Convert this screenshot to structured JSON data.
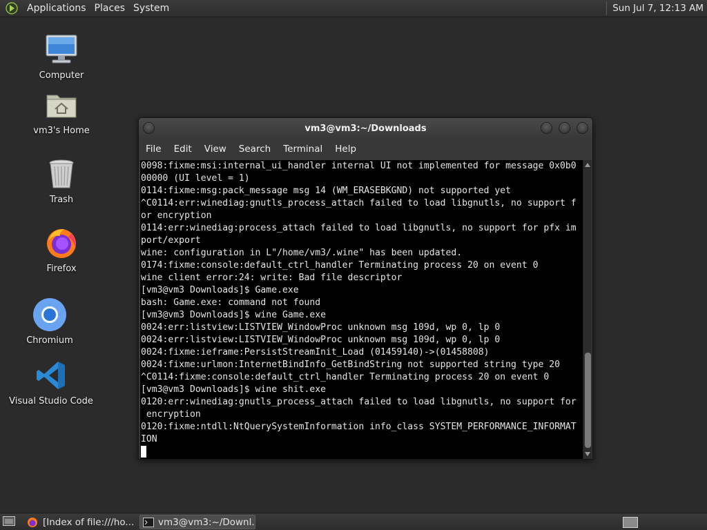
{
  "top_panel": {
    "menus": [
      "Applications",
      "Places",
      "System"
    ],
    "clock": "Sun Jul  7, 12:13 AM"
  },
  "desktop": {
    "icons": [
      {
        "label": "Computer",
        "icon": "computer-icon"
      },
      {
        "label": "vm3's Home",
        "icon": "home-folder-icon"
      },
      {
        "label": "Trash",
        "icon": "trash-icon"
      },
      {
        "label": "Firefox",
        "icon": "firefox-icon"
      },
      {
        "label": "Chromium",
        "icon": "chromium-icon"
      },
      {
        "label": "Visual Studio Code",
        "icon": "vscode-icon"
      }
    ]
  },
  "terminal": {
    "title": "vm3@vm3:~/Downloads",
    "menu": [
      "File",
      "Edit",
      "View",
      "Search",
      "Terminal",
      "Help"
    ],
    "lines": [
      "0098:fixme:msi:internal_ui_handler internal UI not implemented for message 0x0b0",
      "00000 (UI level = 1)",
      "0114:fixme:msg:pack_message msg 14 (WM_ERASEBKGND) not supported yet",
      "^C0114:err:winediag:gnutls_process_attach failed to load libgnutls, no support f",
      "or encryption",
      "0114:err:winediag:process_attach failed to load libgnutls, no support for pfx im",
      "port/export",
      "wine: configuration in L\"/home/vm3/.wine\" has been updated.",
      "0174:fixme:console:default_ctrl_handler Terminating process 20 on event 0",
      "wine client error:24: write: Bad file descriptor",
      "[vm3@vm3 Downloads]$ Game.exe",
      "bash: Game.exe: command not found",
      "[vm3@vm3 Downloads]$ wine Game.exe",
      "0024:err:listview:LISTVIEW_WindowProc unknown msg 109d, wp 0, lp 0",
      "0024:err:listview:LISTVIEW_WindowProc unknown msg 109d, wp 0, lp 0",
      "0024:fixme:ieframe:PersistStreamInit_Load (01459140)->(01458808)",
      "0024:fixme:urlmon:InternetBindInfo_GetBindString not supported string type 20",
      "^C0114:fixme:console:default_ctrl_handler Terminating process 20 on event 0",
      "[vm3@vm3 Downloads]$ wine shit.exe",
      "0120:err:winediag:gnutls_process_attach failed to load libgnutls, no support for",
      " encryption",
      "0120:fixme:ntdll:NtQuerySystemInformation info_class SYSTEM_PERFORMANCE_INFORMAT",
      "ION"
    ]
  },
  "taskbar": {
    "tasks": [
      {
        "label": "[Index of file:///ho...",
        "icon": "firefox-icon"
      },
      {
        "label": "vm3@vm3:~/Downl...",
        "icon": "terminal-icon"
      }
    ]
  }
}
